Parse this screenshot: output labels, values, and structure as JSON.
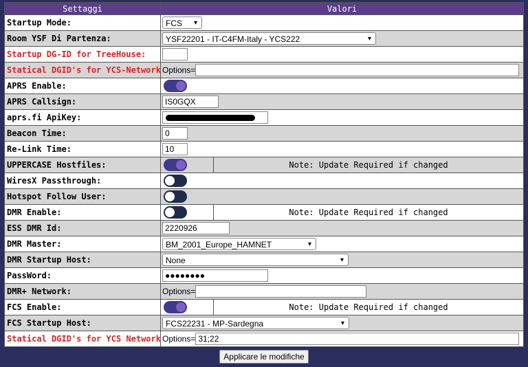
{
  "header": {
    "col1": "Settaggi",
    "col2": "Valori"
  },
  "rows": {
    "startup_mode": {
      "label": "Startup Mode:",
      "value": "FCS"
    },
    "room_ysf": {
      "label": "Room YSF Di Partenza:",
      "value": "YSF22201 - IT-C4FM-Italy - YCS222"
    },
    "startup_dgid": {
      "label": "Startup DG-ID for TreeHouse:",
      "value": ""
    },
    "statical_dgid_net": {
      "label": "Statical DGID's for YCS-Network:",
      "prefix": "Options=",
      "value": ""
    },
    "aprs_enable": {
      "label": "APRS Enable:",
      "state": "on"
    },
    "aprs_callsign": {
      "label": "APRS Callsign:",
      "value": "IS0GQX"
    },
    "aprs_apikey": {
      "label": "aprs.fi ApiKey:",
      "value": ""
    },
    "beacon_time": {
      "label": "Beacon Time:",
      "value": "0"
    },
    "relink_time": {
      "label": "Re-Link Time:",
      "value": "10"
    },
    "uppercase_hostfiles": {
      "label": "UPPERCASE Hostfiles:",
      "state": "on",
      "note": "Note: Update Required if changed"
    },
    "wiresx_passthrough": {
      "label": "WiresX Passthrough:",
      "state": "off"
    },
    "hotspot_follow_user": {
      "label": "Hotspot Follow User:",
      "state": "off"
    },
    "dmr_enable": {
      "label": "DMR Enable:",
      "state": "off",
      "note": "Note: Update Required if changed"
    },
    "ess_dmr_id": {
      "label": "ESS DMR Id:",
      "value": "2220926"
    },
    "dmr_master": {
      "label": "DMR Master:",
      "value": "BM_2001_Europe_HAMNET"
    },
    "dmr_startup_host": {
      "label": "DMR Startup Host:",
      "value": "None"
    },
    "password": {
      "label": "PassWord:",
      "value": "●●●●●●●●"
    },
    "dmr_plus_network": {
      "label": "DMR+ Network:",
      "prefix": "Options=",
      "value": ""
    },
    "fcs_enable": {
      "label": "FCS Enable:",
      "state": "on",
      "note": "Note: Update Required if changed"
    },
    "fcs_startup_host": {
      "label": "FCS Startup Host:",
      "value": "FCS22231 - MP-Sardegna"
    },
    "statical_dgid_ycs": {
      "label": "Statical DGID's for YCS Network",
      "prefix": "Options=",
      "value": "31;22"
    }
  },
  "apply_button": "Applicare le modifiche",
  "colors": {
    "header_bg": "#5a3e8a",
    "page_bg": "#2b2d5e",
    "toggle_on": "#3e3a8e",
    "toggle_off": "#1f2b4a",
    "red_label": "#e02020"
  }
}
